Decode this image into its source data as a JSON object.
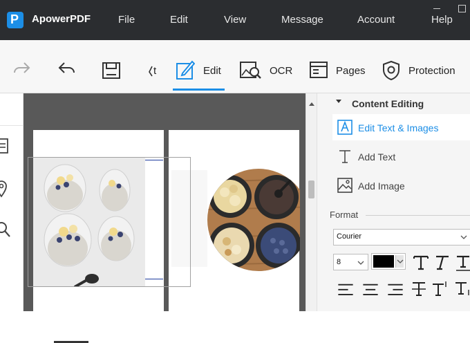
{
  "app": {
    "title": "ApowerPDF",
    "logo_letter": "P"
  },
  "menu": [
    "File",
    "Edit",
    "View",
    "Message",
    "Account",
    "Help"
  ],
  "toolbar": {
    "edit_label": "Edit",
    "ocr_label": "OCR",
    "pages_label": "Pages",
    "protection_label": "Protection",
    "partial_label": "t",
    "active_tool": "Edit",
    "accent": "#1c8ee6"
  },
  "document": {
    "page2_photo_alt": "Bowls of banana chips, chia pudding, coconut and blueberries on wooden board",
    "page1_photo_alt": "Chia pudding parfaits with banana and blueberries"
  },
  "right_panel": {
    "section_title": "Content Editing",
    "items": [
      {
        "label": "Edit Text & Images",
        "icon": "edit-text-image-icon",
        "active": true
      },
      {
        "label": "Add Text",
        "icon": "text-icon",
        "active": false
      },
      {
        "label": "Add Image",
        "icon": "image-icon",
        "active": false
      }
    ],
    "format": {
      "label": "Format",
      "font": "Courier",
      "size": "8",
      "color": "#000000"
    }
  }
}
